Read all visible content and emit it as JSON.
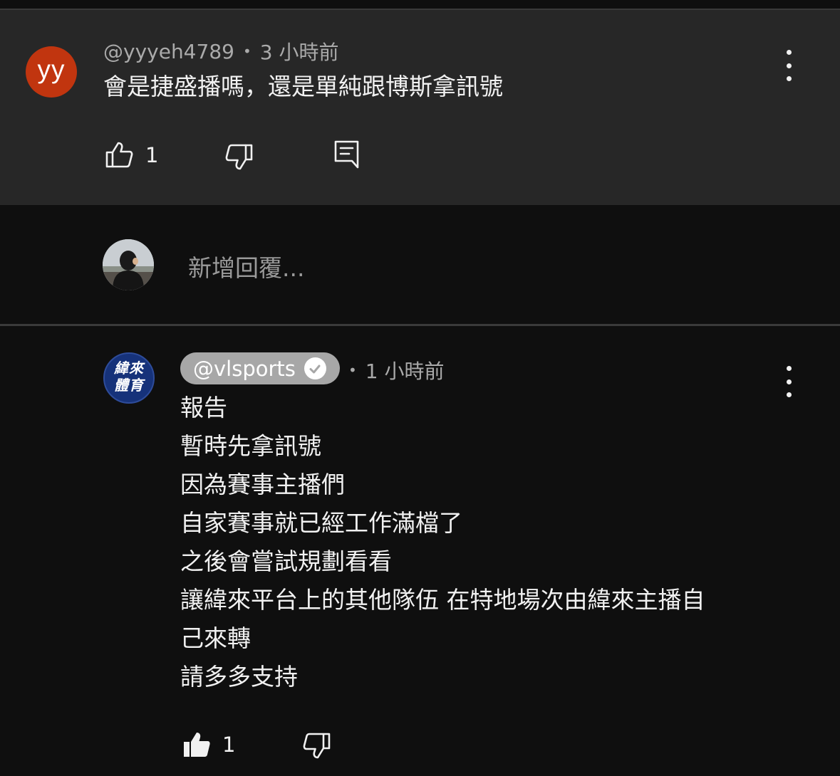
{
  "comment": {
    "avatar_initials": "yy",
    "avatar_color": "#c1350f",
    "author": "@yyyeh4789",
    "separator": "•",
    "time": "3 小時前",
    "text": "會是捷盛播嗎，還是單純跟博斯拿訊號",
    "like_count": "1",
    "icons": [
      "thumb-up-icon",
      "thumb-down-icon",
      "comment-reply-icon",
      "more-vert-icon"
    ]
  },
  "reply_input": {
    "placeholder": "新增回覆..."
  },
  "reply": {
    "avatar_text": "緯來\n體育",
    "author": "@vlsports",
    "verified": true,
    "separator": "•",
    "time": "1 小時前",
    "lines": [
      "報告",
      "暫時先拿訊號",
      "因為賽事主播們",
      "自家賽事就已經工作滿檔了",
      "之後會嘗試規劃看看",
      "讓緯來平台上的其他隊伍 在特地場次由緯來主播自",
      "己來轉",
      "請多多支持"
    ],
    "like_count": "1",
    "liked": true
  },
  "colors": {
    "background": "#0f0f0f",
    "card": "#272727",
    "text": "#f1f1f1",
    "muted": "#aaaaaa",
    "chip": "#a7a7a7"
  }
}
